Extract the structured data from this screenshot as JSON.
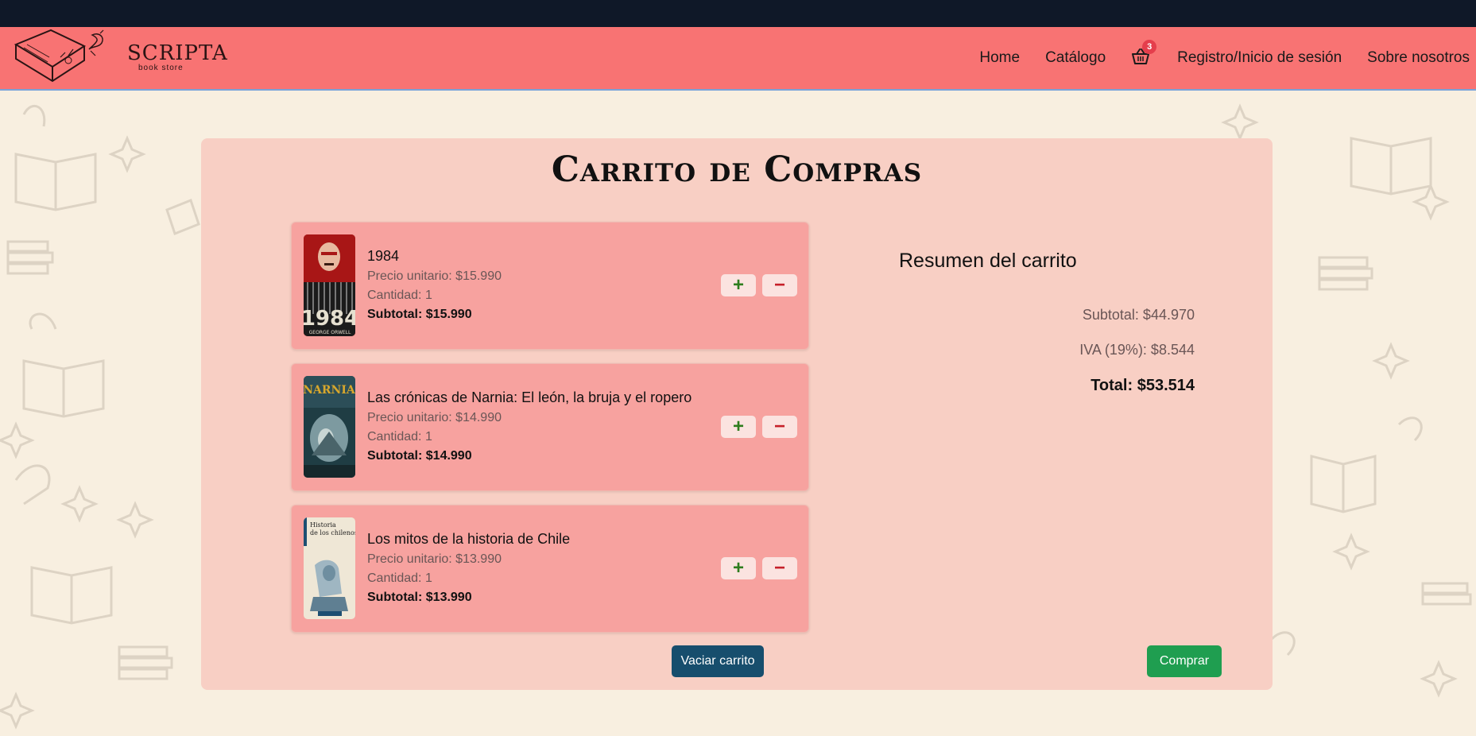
{
  "brand": {
    "name": "SCRIPTA",
    "tagline": "book store"
  },
  "nav": {
    "home": "Home",
    "catalog": "Catálogo",
    "cart_count": "3",
    "login": "Registro/Inicio de sesión",
    "about": "Sobre nosotros"
  },
  "page": {
    "title": "Carrito de Compras"
  },
  "cart_items": [
    {
      "title": "1984",
      "unit_price": "Precio unitario: $15.990",
      "quantity": "Cantidad: 1",
      "subtotal": "Subtotal: $15.990",
      "cover_text": "1984",
      "cover_author": "GEORGE ORWELL"
    },
    {
      "title": "Las crónicas de Narnia: El león, la bruja y el ropero",
      "unit_price": "Precio unitario: $14.990",
      "quantity": "Cantidad: 1",
      "subtotal": "Subtotal: $14.990",
      "cover_text": "NARNIA"
    },
    {
      "title": "Los mitos de la historia de Chile",
      "unit_price": "Precio unitario: $13.990",
      "quantity": "Cantidad: 1",
      "subtotal": "Subtotal: $13.990",
      "cover_text": "Historia de los chilenos"
    }
  ],
  "summary": {
    "title": "Resumen del carrito",
    "subtotal": "Subtotal: $44.970",
    "iva": "IVA (19%): $8.544",
    "total": "Total: $53.514"
  },
  "buttons": {
    "plus": "+",
    "minus": "−",
    "clear": "Vaciar carrito",
    "buy": "Comprar"
  },
  "colors": {
    "navbar": "#f87373",
    "panel": "#f8cfc4",
    "card": "#f7a29f",
    "clear_button": "#174e6d",
    "buy_button": "#1f9e50"
  }
}
